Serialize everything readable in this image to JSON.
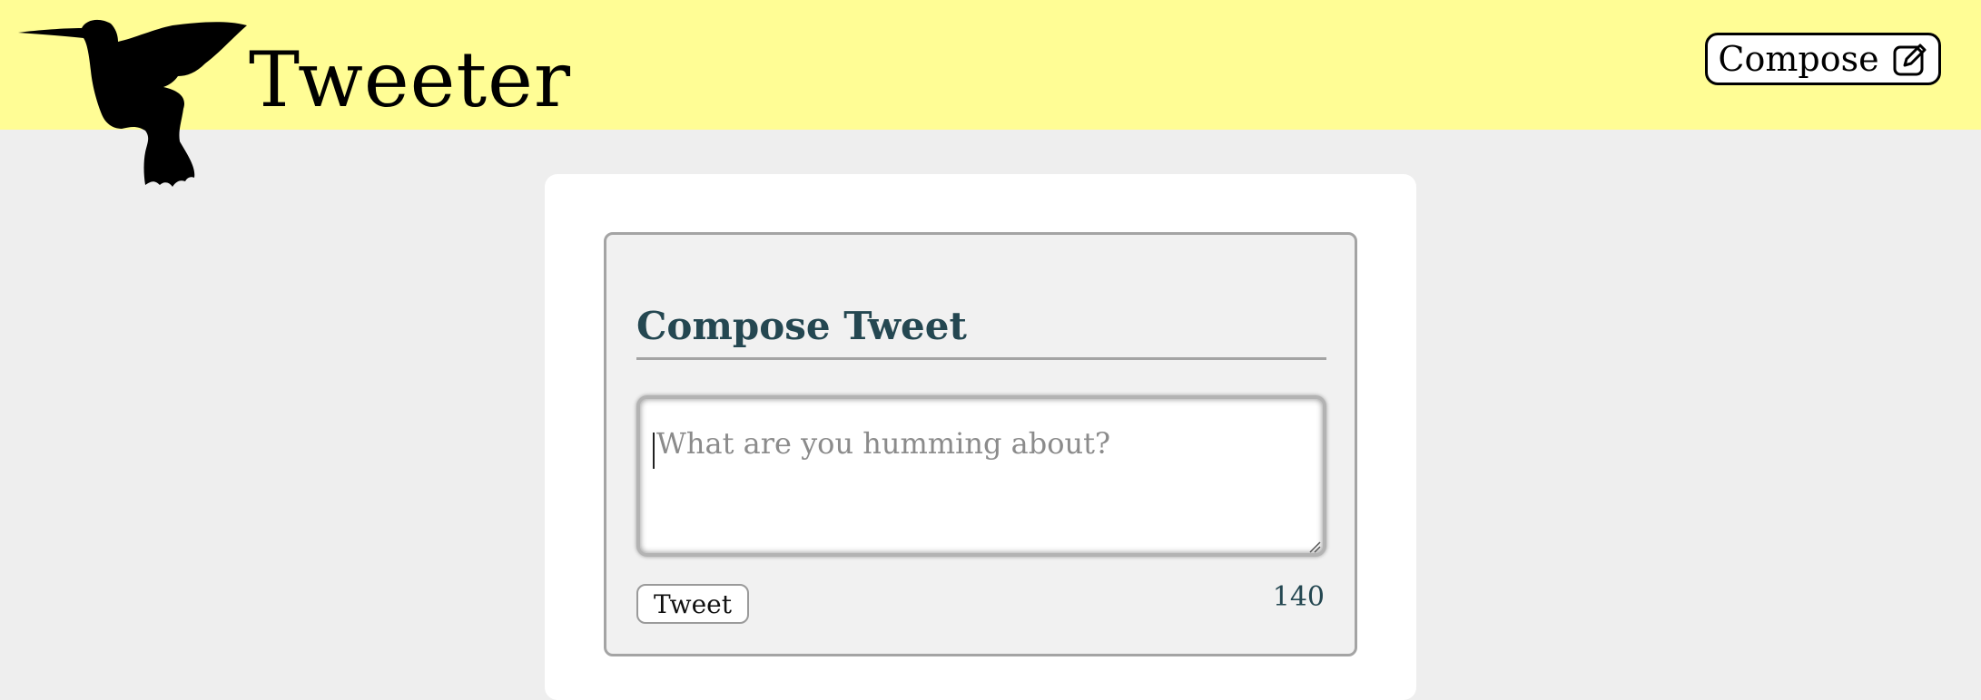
{
  "app": {
    "name": "Tweeter"
  },
  "header": {
    "logo_icon": "hummingbird-icon",
    "compose_label": "Compose",
    "compose_icon": "edit-icon"
  },
  "compose_panel": {
    "title": "Compose Tweet",
    "textarea_value": "",
    "textarea_placeholder": "What are you humming about?",
    "tweet_button_label": "Tweet",
    "char_counter": "140"
  },
  "colors": {
    "header_bg": "#fffd95",
    "page_bg": "#eeeeee",
    "title_color": "#244751",
    "panel_bg": "#f1f1f1",
    "border": "#a4a4a4"
  }
}
